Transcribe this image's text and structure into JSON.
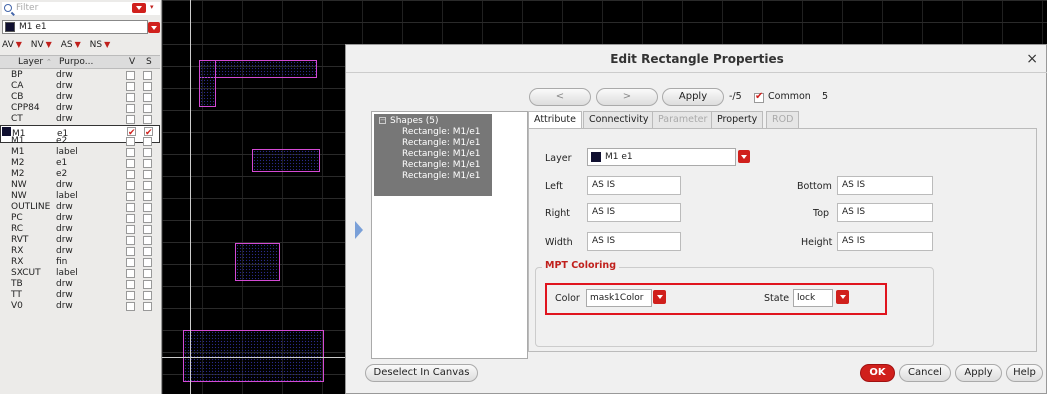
{
  "left_panel": {
    "filter_placeholder": "Filter",
    "current_layer": "M1 e1",
    "visibility_labels": [
      "AV",
      "NV",
      "AS",
      "NS"
    ],
    "columns": {
      "layer": "Layer",
      "purpose": "Purpo...",
      "v": "V",
      "s": "S"
    },
    "rows": [
      {
        "layer": "BP",
        "purpose": "drw",
        "v": false,
        "s": false
      },
      {
        "layer": "CA",
        "purpose": "drw",
        "v": false,
        "s": false
      },
      {
        "layer": "CB",
        "purpose": "drw",
        "v": false,
        "s": false
      },
      {
        "layer": "CPP84",
        "purpose": "drw",
        "v": false,
        "s": false
      },
      {
        "layer": "CT",
        "purpose": "drw",
        "v": false,
        "s": false
      },
      {
        "layer": "M1",
        "purpose": "e1",
        "v": true,
        "s": true,
        "selected": true
      },
      {
        "layer": "M1",
        "purpose": "e2",
        "v": false,
        "s": false
      },
      {
        "layer": "M1",
        "purpose": "label",
        "v": false,
        "s": false
      },
      {
        "layer": "M2",
        "purpose": "e1",
        "v": false,
        "s": false
      },
      {
        "layer": "M2",
        "purpose": "e2",
        "v": false,
        "s": false
      },
      {
        "layer": "NW",
        "purpose": "drw",
        "v": false,
        "s": false
      },
      {
        "layer": "NW",
        "purpose": "label",
        "v": false,
        "s": false
      },
      {
        "layer": "OUTLINE",
        "purpose": "drw",
        "v": false,
        "s": false
      },
      {
        "layer": "PC",
        "purpose": "drw",
        "v": false,
        "s": false
      },
      {
        "layer": "RC",
        "purpose": "drw",
        "v": false,
        "s": false
      },
      {
        "layer": "RVT",
        "purpose": "drw",
        "v": false,
        "s": false
      },
      {
        "layer": "RX",
        "purpose": "drw",
        "v": false,
        "s": false
      },
      {
        "layer": "RX",
        "purpose": "fin",
        "v": false,
        "s": false
      },
      {
        "layer": "SXCUT",
        "purpose": "label",
        "v": false,
        "s": false
      },
      {
        "layer": "TB",
        "purpose": "drw",
        "v": false,
        "s": false
      },
      {
        "layer": "TT",
        "purpose": "drw",
        "v": false,
        "s": false
      },
      {
        "layer": "V0",
        "purpose": "drw",
        "v": false,
        "s": false
      }
    ]
  },
  "dialog": {
    "title": "Edit Rectangle Properties",
    "close_glyph": "×",
    "nav": {
      "prev": "<",
      "next": ">",
      "apply": "Apply",
      "count": "-/5",
      "common_label": "Common",
      "common_count": "5"
    },
    "tree": {
      "root": "Shapes (5)",
      "items": [
        "Rectangle: M1/e1",
        "Rectangle: M1/e1",
        "Rectangle: M1/e1",
        "Rectangle: M1/e1",
        "Rectangle: M1/e1"
      ]
    },
    "tabs": [
      "Attribute",
      "Connectivity",
      "Parameter",
      "Property",
      "ROD"
    ],
    "fields": {
      "layer_label": "Layer",
      "layer_value": "M1 e1",
      "left_label": "Left",
      "left_value": "AS IS",
      "bottom_label": "Bottom",
      "bottom_value": "AS IS",
      "right_label": "Right",
      "right_value": "AS IS",
      "top_label": "Top",
      "top_value": "AS IS",
      "width_label": "Width",
      "width_value": "AS IS",
      "height_label": "Height",
      "height_value": "AS IS"
    },
    "mpt": {
      "group_label": "MPT Coloring",
      "color_label": "Color",
      "color_value": "mask1Color",
      "state_label": "State",
      "state_value": "lock"
    },
    "footer": {
      "deselect": "Deselect In Canvas",
      "ok": "OK",
      "cancel": "Cancel",
      "apply": "Apply",
      "help": "Help"
    }
  },
  "colors": {
    "accent_red": "#d0201c",
    "shape_outline": "#d44ad4",
    "highlight": "#e0141e"
  }
}
